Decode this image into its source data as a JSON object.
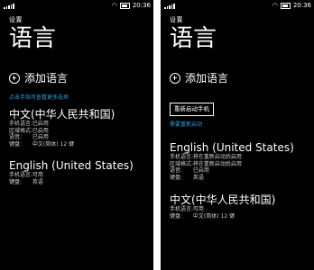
{
  "left_phone": {
    "status": {
      "network": "",
      "time": "20:36"
    },
    "breadcrumb": "设置",
    "title": "语言",
    "add_label": "添加语言",
    "link": "点击手指可查看更多选项",
    "languages": [
      {
        "name": "中文(中华人民共和国)",
        "details": [
          {
            "k": "手机语言:",
            "v": "已启用"
          },
          {
            "k": "区域格式:",
            "v": "已启用"
          },
          {
            "k": "语音:",
            "v": "已启用"
          },
          {
            "k": "键盘:",
            "v": "中文(简体) 12 键"
          }
        ]
      },
      {
        "name": "English (United States)",
        "details": [
          {
            "k": "手机语言:",
            "v": "可用"
          },
          {
            "k": "键盘:",
            "v": "英语"
          }
        ]
      }
    ]
  },
  "right_phone": {
    "status": {
      "network": "",
      "time": "20:36"
    },
    "breadcrumb": "设置",
    "title": "语言",
    "add_label": "添加语言",
    "restart_label": "重新启动手机",
    "link": "需要重新启动",
    "languages": [
      {
        "name": "English (United States)",
        "details": [
          {
            "k": "手机语言:",
            "v": "将在重新启动后启用"
          },
          {
            "k": "区域格式:",
            "v": "将在重新启动后启用"
          },
          {
            "k": "语音:",
            "v": "已启用"
          },
          {
            "k": "键盘:",
            "v": "英语"
          }
        ]
      },
      {
        "name": "中文(中华人民共和国)",
        "details": [
          {
            "k": "手机语言:",
            "v": "可用"
          },
          {
            "k": "键盘:",
            "v": "中文(简体) 12 键"
          }
        ]
      }
    ]
  }
}
